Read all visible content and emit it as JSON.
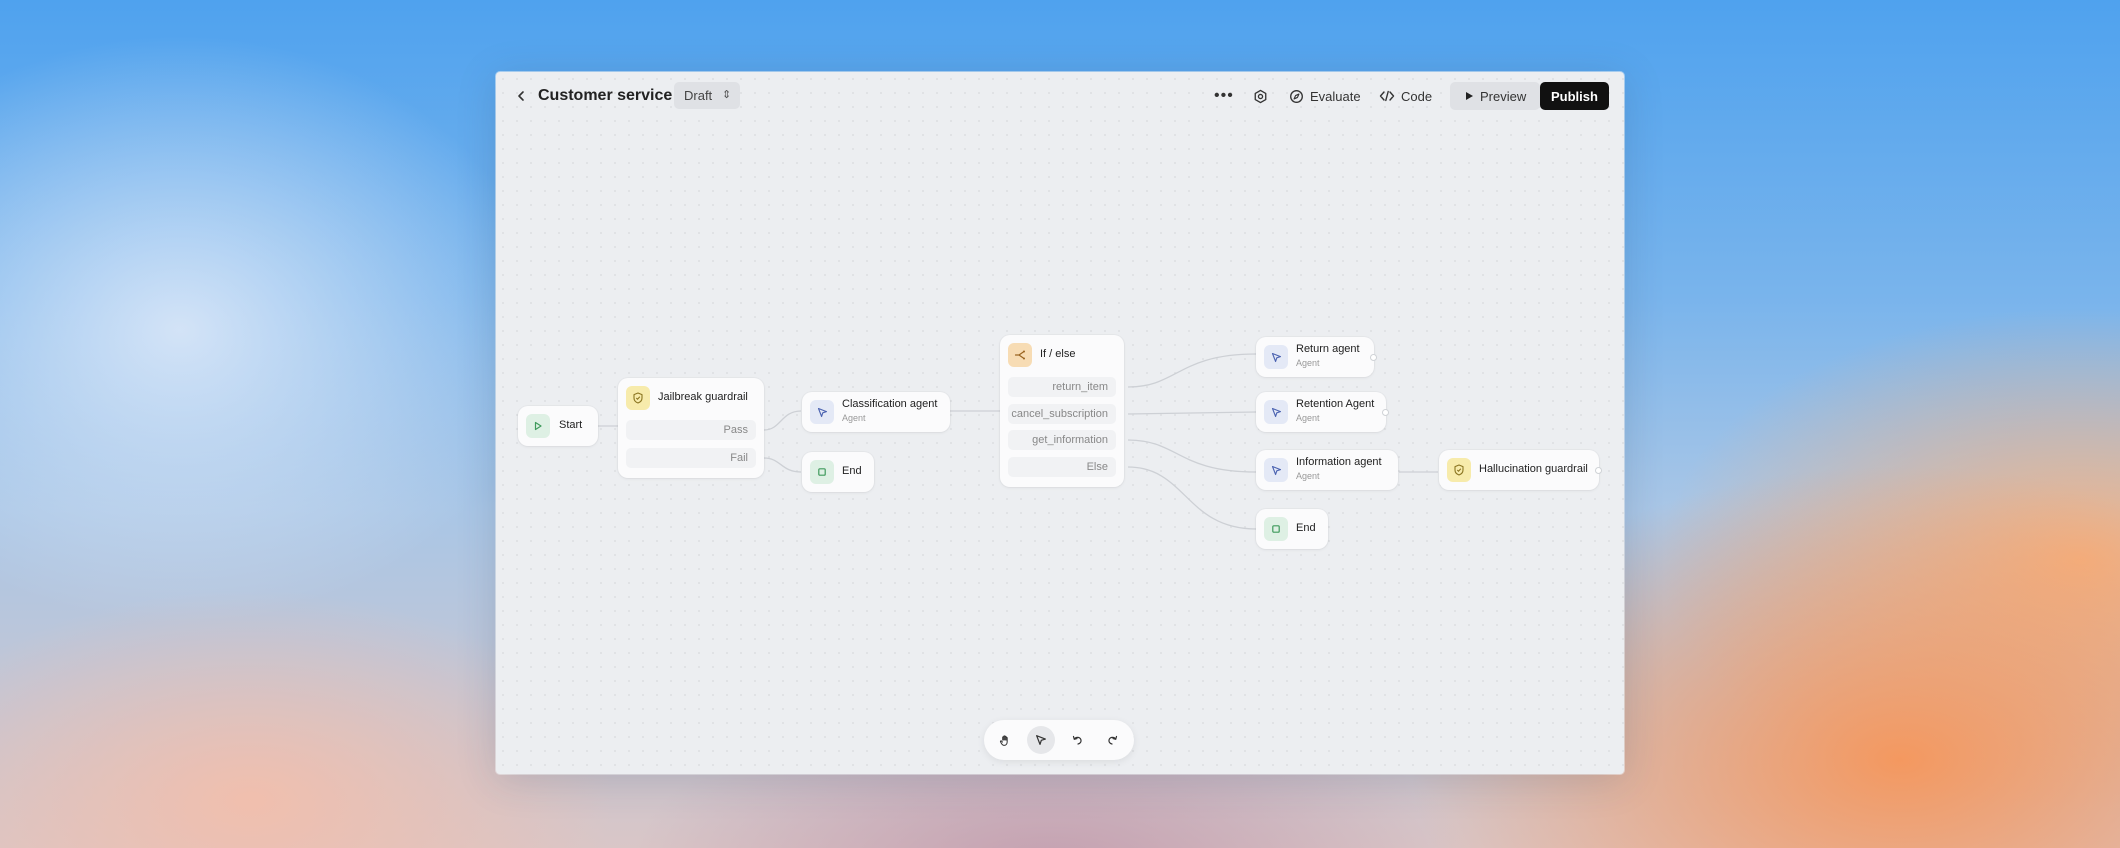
{
  "header": {
    "title": "Customer service",
    "status": "Draft",
    "evaluate_label": "Evaluate",
    "code_label": "Code",
    "preview_label": "Preview",
    "publish_label": "Publish"
  },
  "nodes": {
    "start": {
      "label": "Start"
    },
    "jailbreak": {
      "label": "Jailbreak guardrail",
      "outputs": [
        "Pass",
        "Fail"
      ]
    },
    "classification": {
      "label": "Classification agent",
      "sub": "Agent"
    },
    "end1": {
      "label": "End"
    },
    "ifelse": {
      "label": "If / else",
      "outputs": [
        "return_item",
        "cancel_subscription",
        "get_information",
        "Else"
      ]
    },
    "return_agent": {
      "label": "Return agent",
      "sub": "Agent"
    },
    "retention_agent": {
      "label": "Retention Agent",
      "sub": "Agent"
    },
    "information_agent": {
      "label": "Information agent",
      "sub": "Agent"
    },
    "end2": {
      "label": "End"
    },
    "hallucination": {
      "label": "Hallucination guardrail"
    }
  },
  "toolbar": [
    "hand-icon",
    "pointer-icon",
    "undo-icon",
    "redo-icon"
  ],
  "colors": {
    "start_icon": "#def0e4",
    "agent_icon": "#e4e9f6",
    "guardrail_icon": "#f7ebab",
    "ifelse_icon": "#f7dcb4",
    "publish_bg": "#111111"
  }
}
